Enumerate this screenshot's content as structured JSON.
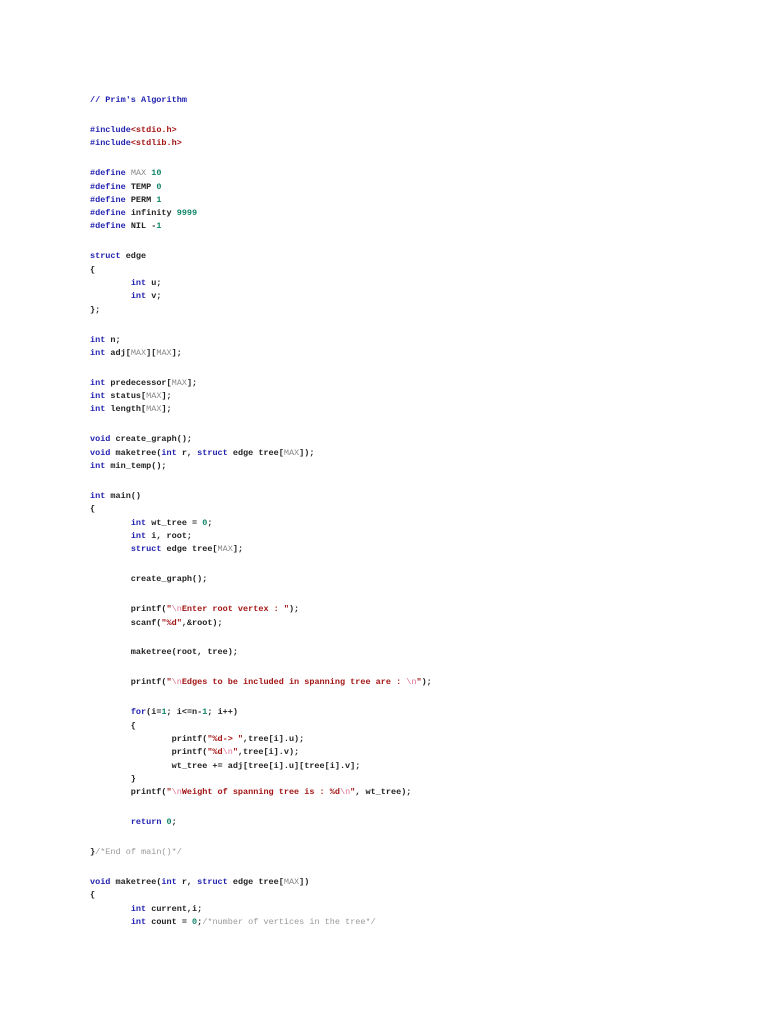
{
  "document": {
    "lines": [
      [
        [
          "// Prim's Algorithm",
          "k"
        ]
      ],
      [],
      [
        [
          "#include",
          "k"
        ],
        [
          "<stdio.h>",
          "s"
        ]
      ],
      [
        [
          "#include",
          "k"
        ],
        [
          "<stdlib.h>",
          "s"
        ]
      ],
      [],
      [
        [
          "#define ",
          "k"
        ],
        [
          "MAX",
          "m"
        ],
        [
          " ",
          "t"
        ],
        [
          "10",
          "n"
        ]
      ],
      [
        [
          "#define ",
          "k"
        ],
        [
          "TEMP ",
          "t"
        ],
        [
          "0",
          "n"
        ]
      ],
      [
        [
          "#define ",
          "k"
        ],
        [
          "PERM ",
          "t"
        ],
        [
          "1",
          "n"
        ]
      ],
      [
        [
          "#define ",
          "k"
        ],
        [
          "infinity ",
          "t"
        ],
        [
          "9999",
          "n"
        ]
      ],
      [
        [
          "#define ",
          "k"
        ],
        [
          "NIL -",
          "t"
        ],
        [
          "1",
          "n"
        ]
      ],
      [],
      [
        [
          "struct",
          "k"
        ],
        [
          " edge",
          "t"
        ]
      ],
      [
        [
          "{",
          "t"
        ]
      ],
      [
        [
          "        ",
          "t"
        ],
        [
          "int",
          "k"
        ],
        [
          " u;",
          "t"
        ]
      ],
      [
        [
          "        ",
          "t"
        ],
        [
          "int",
          "k"
        ],
        [
          " v;",
          "t"
        ]
      ],
      [
        [
          "};",
          "t"
        ]
      ],
      [],
      [
        [
          "int",
          "k"
        ],
        [
          " n;",
          "t"
        ]
      ],
      [
        [
          "int",
          "k"
        ],
        [
          " adj[",
          "t"
        ],
        [
          "MAX",
          "m"
        ],
        [
          "][",
          "t"
        ],
        [
          "MAX",
          "m"
        ],
        [
          "];",
          "t"
        ]
      ],
      [],
      [
        [
          "int",
          "k"
        ],
        [
          " predecessor[",
          "t"
        ],
        [
          "MAX",
          "m"
        ],
        [
          "];",
          "t"
        ]
      ],
      [
        [
          "int",
          "k"
        ],
        [
          " status[",
          "t"
        ],
        [
          "MAX",
          "m"
        ],
        [
          "];",
          "t"
        ]
      ],
      [
        [
          "int",
          "k"
        ],
        [
          " length[",
          "t"
        ],
        [
          "MAX",
          "m"
        ],
        [
          "];",
          "t"
        ]
      ],
      [],
      [
        [
          "void",
          "k"
        ],
        [
          " create_graph();",
          "t"
        ]
      ],
      [
        [
          "void",
          "k"
        ],
        [
          " maketree(",
          "t"
        ],
        [
          "int",
          "k"
        ],
        [
          " r, ",
          "t"
        ],
        [
          "struct",
          "k"
        ],
        [
          " edge tree[",
          "t"
        ],
        [
          "MAX",
          "m"
        ],
        [
          "]);",
          "t"
        ]
      ],
      [
        [
          "int",
          "k"
        ],
        [
          " min_temp();",
          "t"
        ]
      ],
      [],
      [
        [
          "int",
          "k"
        ],
        [
          " main()",
          "t"
        ]
      ],
      [
        [
          "{",
          "t"
        ]
      ],
      [
        [
          "        ",
          "t"
        ],
        [
          "int",
          "k"
        ],
        [
          " wt_tree = ",
          "t"
        ],
        [
          "0",
          "n"
        ],
        [
          ";",
          "t"
        ]
      ],
      [
        [
          "        ",
          "t"
        ],
        [
          "int",
          "k"
        ],
        [
          " i, root;",
          "t"
        ]
      ],
      [
        [
          "        ",
          "t"
        ],
        [
          "struct",
          "k"
        ],
        [
          " edge tree[",
          "t"
        ],
        [
          "MAX",
          "m"
        ],
        [
          "];",
          "t"
        ]
      ],
      [],
      [
        [
          "        create_graph();",
          "t"
        ]
      ],
      [],
      [
        [
          "        printf(",
          "t"
        ],
        [
          "\"",
          "s"
        ],
        [
          "\\n",
          "e"
        ],
        [
          "Enter root vertex : \"",
          "s"
        ],
        [
          ");",
          "t"
        ]
      ],
      [
        [
          "        scanf(",
          "t"
        ],
        [
          "\"%d\"",
          "s"
        ],
        [
          ",&root);",
          "t"
        ]
      ],
      [],
      [
        [
          "        maketree(root, tree);",
          "t"
        ]
      ],
      [],
      [
        [
          "        printf(",
          "t"
        ],
        [
          "\"",
          "s"
        ],
        [
          "\\n",
          "e"
        ],
        [
          "Edges to be included in spanning tree are : ",
          "s"
        ],
        [
          "\\n",
          "e"
        ],
        [
          "\"",
          "s"
        ],
        [
          ");",
          "t"
        ]
      ],
      [],
      [
        [
          "        ",
          "t"
        ],
        [
          "for",
          "k"
        ],
        [
          "(i=",
          "t"
        ],
        [
          "1",
          "n"
        ],
        [
          "; i<=n-",
          "t"
        ],
        [
          "1",
          "n"
        ],
        [
          "; i++)",
          "t"
        ]
      ],
      [
        [
          "        {",
          "t"
        ]
      ],
      [
        [
          "                printf(",
          "t"
        ],
        [
          "\"%d-> \"",
          "s"
        ],
        [
          ",tree[i].u);",
          "t"
        ]
      ],
      [
        [
          "                printf(",
          "t"
        ],
        [
          "\"%d",
          "s"
        ],
        [
          "\\n",
          "e"
        ],
        [
          "\"",
          "s"
        ],
        [
          ",tree[i].v);",
          "t"
        ]
      ],
      [
        [
          "                wt_tree += adj[tree[i].u][tree[i].v];",
          "t"
        ]
      ],
      [
        [
          "        }",
          "t"
        ]
      ],
      [
        [
          "        printf(",
          "t"
        ],
        [
          "\"",
          "s"
        ],
        [
          "\\n",
          "e"
        ],
        [
          "Weight of spanning tree is : %d",
          "s"
        ],
        [
          "\\n",
          "e"
        ],
        [
          "\"",
          "s"
        ],
        [
          ", wt_tree);",
          "t"
        ]
      ],
      [],
      [
        [
          "        ",
          "t"
        ],
        [
          "return",
          "k"
        ],
        [
          " ",
          "t"
        ],
        [
          "0",
          "n"
        ],
        [
          ";",
          "t"
        ]
      ],
      [],
      [
        [
          "}",
          "t"
        ],
        [
          "/*End of main()*/",
          "c"
        ]
      ],
      [],
      [
        [
          "void",
          "k"
        ],
        [
          " maketree(",
          "t"
        ],
        [
          "int",
          "k"
        ],
        [
          " r, ",
          "t"
        ],
        [
          "struct",
          "k"
        ],
        [
          " edge tree[",
          "t"
        ],
        [
          "MAX",
          "m"
        ],
        [
          "])",
          "t"
        ]
      ],
      [
        [
          "{",
          "t"
        ]
      ],
      [
        [
          "        ",
          "t"
        ],
        [
          "int",
          "k"
        ],
        [
          " current,i;",
          "t"
        ]
      ],
      [
        [
          "        ",
          "t"
        ],
        [
          "int",
          "k"
        ],
        [
          " count = ",
          "t"
        ],
        [
          "0",
          "n"
        ],
        [
          ";",
          "t"
        ],
        [
          "/*number of vertices in the tree*/",
          "c"
        ]
      ]
    ]
  }
}
